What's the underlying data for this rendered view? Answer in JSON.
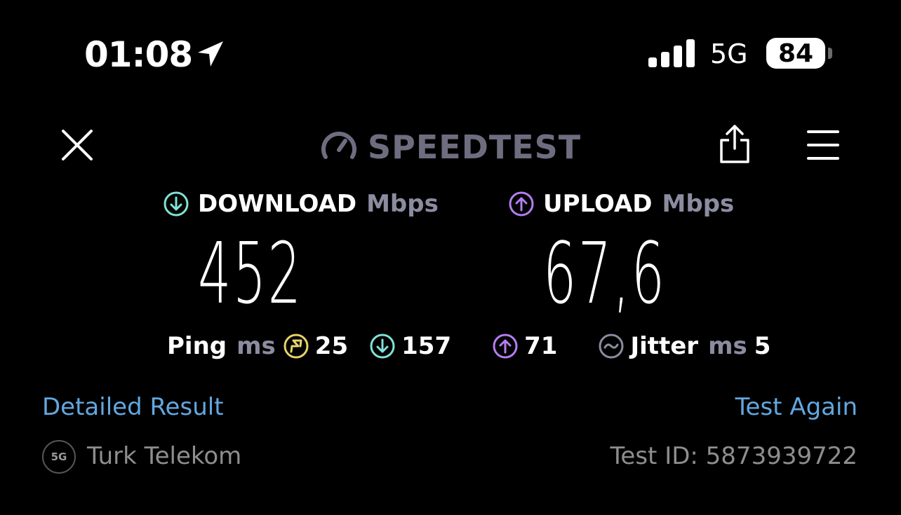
{
  "status_bar": {
    "time": "01:08",
    "network": "5G",
    "battery": "84",
    "icons": [
      "location-arrow-icon",
      "signal-bars-icon"
    ]
  },
  "header": {
    "brand": "SPEEDTEST",
    "icons": [
      "close-icon",
      "speedometer-icon",
      "share-icon",
      "menu-icon"
    ]
  },
  "download": {
    "label": "DOWNLOAD",
    "unit": "Mbps",
    "value": "452",
    "color": "#7fe3d6"
  },
  "upload": {
    "label": "UPLOAD",
    "unit": "Mbps",
    "value": "67,6",
    "color": "#b47ef0"
  },
  "ping": {
    "label": "Ping",
    "unit": "ms",
    "idle": "25",
    "download": "157",
    "upload": "71",
    "idle_color": "#e6d36b"
  },
  "jitter": {
    "label": "Jitter",
    "unit": "ms",
    "value": "5"
  },
  "links": {
    "detailed": "Detailed Result",
    "again": "Test Again"
  },
  "footer": {
    "badge": "5G",
    "provider": "Turk Telekom",
    "test_id": "Test ID: 5873939722"
  }
}
